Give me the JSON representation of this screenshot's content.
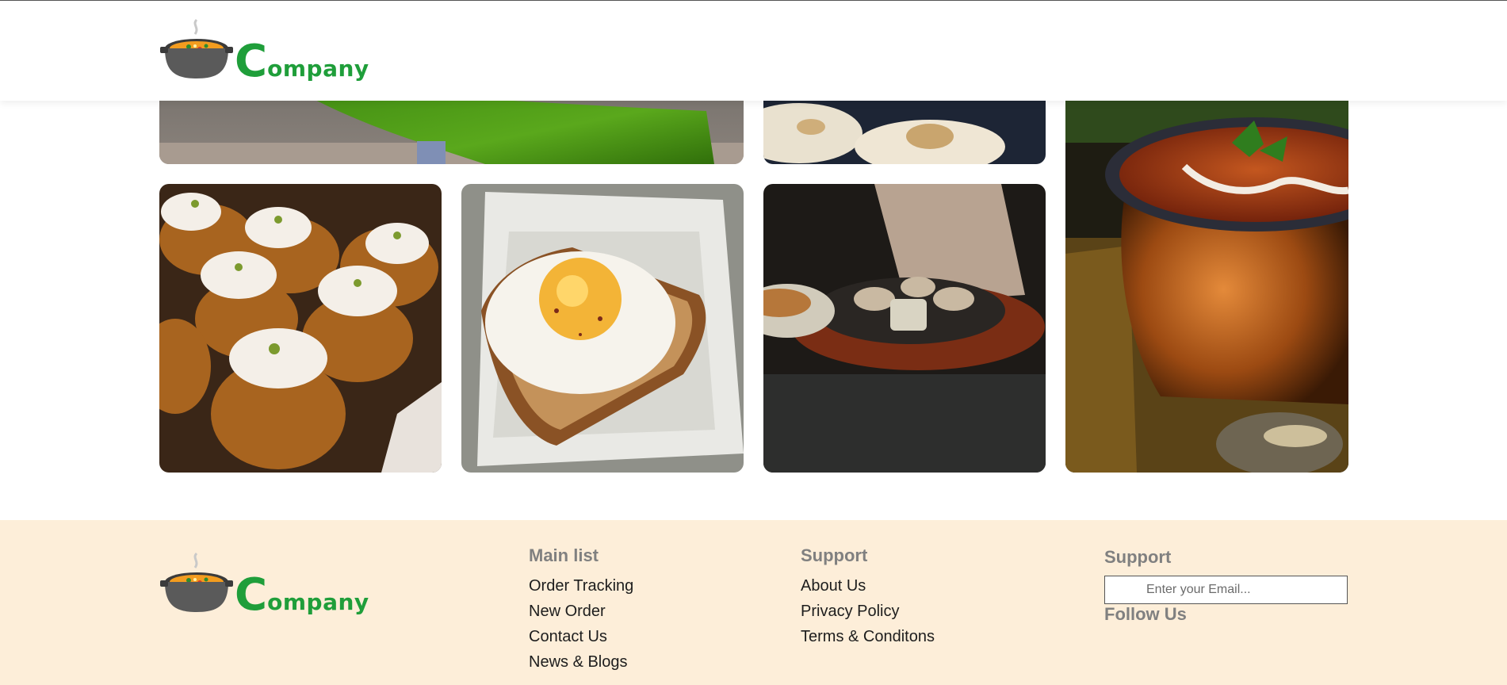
{
  "brand": {
    "name_first": "C",
    "name_rest": "ompany",
    "logo_icon": "soup-pot-icon",
    "color": "#1f9e3a"
  },
  "gallery": {
    "images": [
      {
        "name": "banana-leaf-meal-image"
      },
      {
        "name": "naan-bread-image"
      },
      {
        "name": "curry-pot-image"
      },
      {
        "name": "cream-cupcakes-image"
      },
      {
        "name": "fried-egg-toast-image"
      },
      {
        "name": "sizzler-plate-image"
      }
    ]
  },
  "footer": {
    "background": "#fdeed9",
    "main_list": {
      "title": "Main list",
      "links": [
        "Order Tracking",
        "New Order",
        "Contact Us",
        "News & Blogs"
      ]
    },
    "support_links": {
      "title": "Support",
      "links": [
        "About Us",
        "Privacy Policy",
        "Terms & Conditons"
      ]
    },
    "subscribe": {
      "title": "Support",
      "email_placeholder": "Enter your Email...",
      "email_value": "",
      "follow_title": "Follow Us"
    }
  }
}
